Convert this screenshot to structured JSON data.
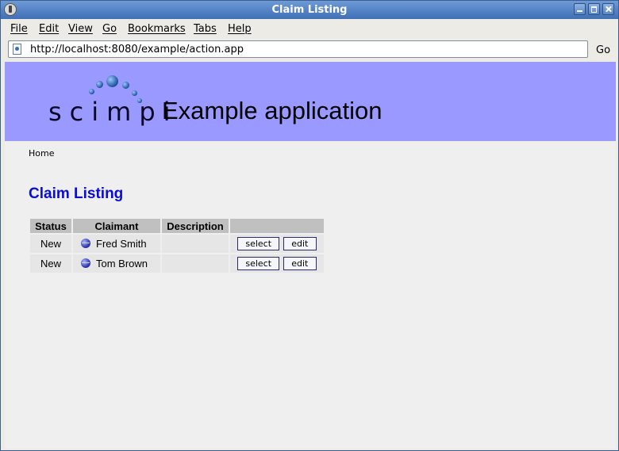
{
  "window": {
    "title": "Claim Listing"
  },
  "menu": [
    "File",
    "Edit",
    "View",
    "Go",
    "Bookmarks",
    "Tabs",
    "Help"
  ],
  "address": {
    "url": "http://localhost:8080/example/action.app",
    "go_label": "Go"
  },
  "banner": {
    "logo": "scimpi",
    "app_title": "Example application",
    "background": "#9999ff"
  },
  "breadcrumb": "Home",
  "page": {
    "title": "Claim Listing",
    "title_color": "#0b0bd6"
  },
  "table": {
    "headers": [
      "Status",
      "Claimant",
      "Description",
      ""
    ],
    "rows": [
      {
        "status": "New",
        "claimant": "Fred Smith",
        "description": "",
        "select_label": "select",
        "edit_label": "edit"
      },
      {
        "status": "New",
        "claimant": "Tom Brown",
        "description": "",
        "select_label": "select",
        "edit_label": "edit"
      }
    ]
  }
}
